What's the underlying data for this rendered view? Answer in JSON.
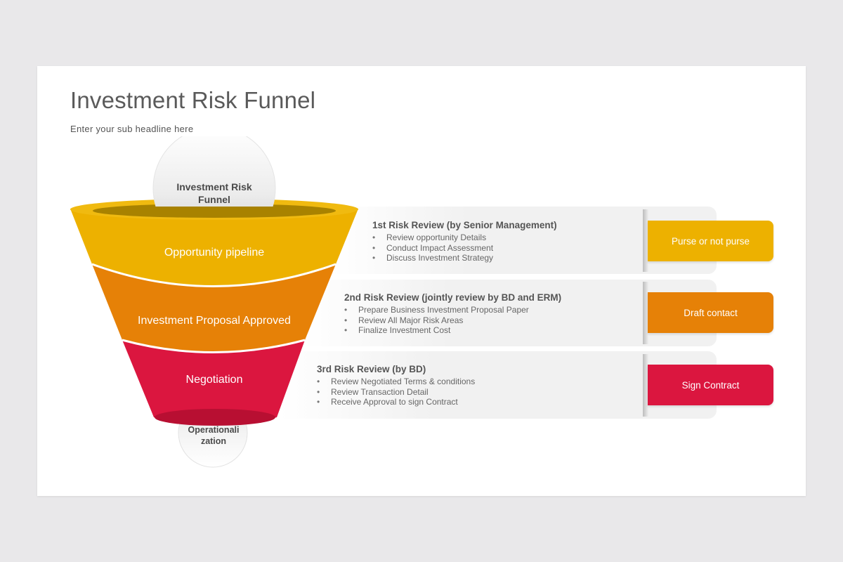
{
  "slide": {
    "title": "Investment Risk Funnel",
    "subtitle": "Enter your sub headline here"
  },
  "funnel": {
    "top_ball_label": "Investment Risk Funnel",
    "bottom_ball_label": "Operationalization",
    "stages": [
      {
        "label": "Opportunity pipeline",
        "color": "#edb100"
      },
      {
        "label": "Investment Proposal Approved",
        "color": "#e68107"
      },
      {
        "label": "Negotiation",
        "color": "#db163f"
      }
    ]
  },
  "reviews": [
    {
      "heading": "1st Risk Review  (by Senior Management)",
      "items": [
        "Review opportunity Details",
        "Conduct Impact Assessment",
        "Discuss Investment Strategy"
      ],
      "outcome": "Purse or not purse",
      "color": "#edb100"
    },
    {
      "heading": "2nd Risk Review (jointly review  by BD and ERM)",
      "items": [
        "Prepare Business Investment Proposal Paper",
        "Review All Major Risk Areas",
        "Finalize Investment Cost"
      ],
      "outcome": "Draft contact",
      "color": "#e68107"
    },
    {
      "heading": "3rd Risk Review  (by BD)",
      "items": [
        "Review Negotiated Terms & conditions",
        "Review Transaction Detail",
        "Receive Approval to sign Contract"
      ],
      "outcome": "Sign Contract",
      "color": "#db163f"
    }
  ]
}
